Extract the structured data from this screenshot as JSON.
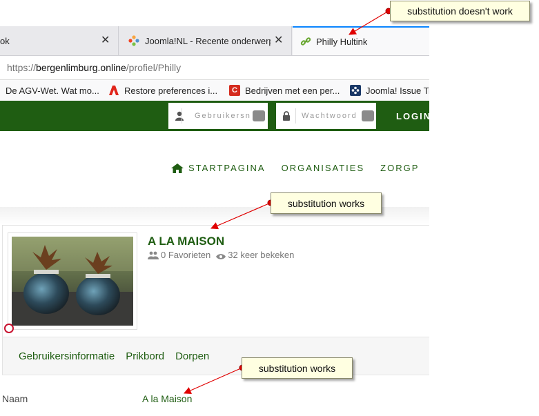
{
  "browser": {
    "tabs": [
      {
        "label": "ok",
        "close": "✕"
      },
      {
        "label": "Joomla!NL - Recente onderwerp",
        "close": "✕"
      },
      {
        "label": "Philly Hultink"
      }
    ],
    "url": {
      "scheme": "https://",
      "host": "bergenlimburg.online",
      "path": "/profiel/Philly"
    },
    "bookmarks": [
      {
        "label": "De AGV-Wet. Wat mo...",
        "icon": "page-icon"
      },
      {
        "label": "Restore preferences i...",
        "icon": "adobe-icon",
        "color": "#e1251b"
      },
      {
        "label": "Bedrijven met een per...",
        "icon": "c-icon",
        "color": "#d52b1e"
      },
      {
        "label": "Joomla! Issue Tr",
        "icon": "joomla-icon",
        "color": "#1a3867"
      }
    ]
  },
  "header": {
    "username_placeholder": "Gebruikersn",
    "password_placeholder": "Wachtwoord",
    "login_label": "LOGIN"
  },
  "nav": {
    "items": [
      "STARTPAGINA",
      "ORGANISATIES",
      "ZORGP"
    ]
  },
  "profile": {
    "name": "A LA MAISON",
    "favorites": "0 Favorieten",
    "views": "32 keer bekeken"
  },
  "subtabs": [
    "Gebruikersinformatie",
    "Prikbord",
    "Dorpen"
  ],
  "fields": [
    {
      "label": "Naam",
      "value": "A la Maison"
    }
  ],
  "annotations": [
    {
      "text": "substitution doesn't work"
    },
    {
      "text": "substitution works"
    },
    {
      "text": "substitution works"
    }
  ],
  "colors": {
    "brand_green": "#1f5d12",
    "callout_bg": "#ffffe1",
    "arrow_red": "#e00000",
    "tab_accent": "#0a84ff"
  }
}
